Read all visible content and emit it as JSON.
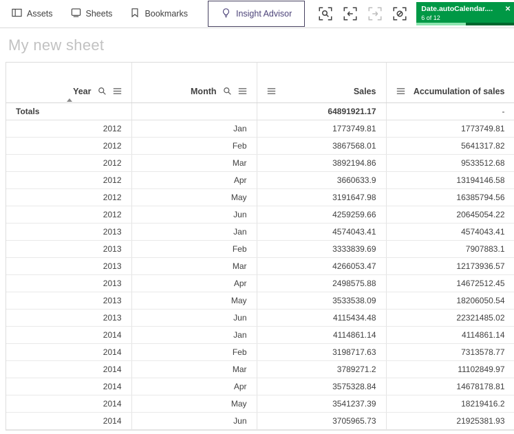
{
  "toolbar": {
    "assets_label": "Assets",
    "sheets_label": "Sheets",
    "bookmarks_label": "Bookmarks",
    "insight_advisor_label": "Insight Advisor",
    "selection_badge": {
      "field": "Date.autoCalendar....",
      "progress": "6 of 12",
      "progress_fraction": 0.5,
      "close": "✕"
    }
  },
  "colors": {
    "selection_green": "#009845",
    "insight_purple": "#4c4379"
  },
  "sheet": {
    "title": "My new sheet"
  },
  "table": {
    "headers": {
      "year": "Year",
      "month": "Month",
      "sales": "Sales",
      "accumulation": "Accumulation of sales"
    },
    "totals": {
      "label": "Totals",
      "sales": "64891921.17",
      "accumulation": "-"
    },
    "rows": [
      [
        "2012",
        "Jan",
        "1773749.81",
        "1773749.81"
      ],
      [
        "2012",
        "Feb",
        "3867568.01",
        "5641317.82"
      ],
      [
        "2012",
        "Mar",
        "3892194.86",
        "9533512.68"
      ],
      [
        "2012",
        "Apr",
        "3660633.9",
        "13194146.58"
      ],
      [
        "2012",
        "May",
        "3191647.98",
        "16385794.56"
      ],
      [
        "2012",
        "Jun",
        "4259259.66",
        "20645054.22"
      ],
      [
        "2013",
        "Jan",
        "4574043.41",
        "4574043.41"
      ],
      [
        "2013",
        "Feb",
        "3333839.69",
        "7907883.1"
      ],
      [
        "2013",
        "Mar",
        "4266053.47",
        "12173936.57"
      ],
      [
        "2013",
        "Apr",
        "2498575.88",
        "14672512.45"
      ],
      [
        "2013",
        "May",
        "3533538.09",
        "18206050.54"
      ],
      [
        "2013",
        "Jun",
        "4115434.48",
        "22321485.02"
      ],
      [
        "2014",
        "Jan",
        "4114861.14",
        "4114861.14"
      ],
      [
        "2014",
        "Feb",
        "3198717.63",
        "7313578.77"
      ],
      [
        "2014",
        "Mar",
        "3789271.2",
        "11102849.97"
      ],
      [
        "2014",
        "Apr",
        "3575328.84",
        "14678178.81"
      ],
      [
        "2014",
        "May",
        "3541237.39",
        "18219416.2"
      ],
      [
        "2014",
        "Jun",
        "3705965.73",
        "21925381.93"
      ]
    ]
  }
}
